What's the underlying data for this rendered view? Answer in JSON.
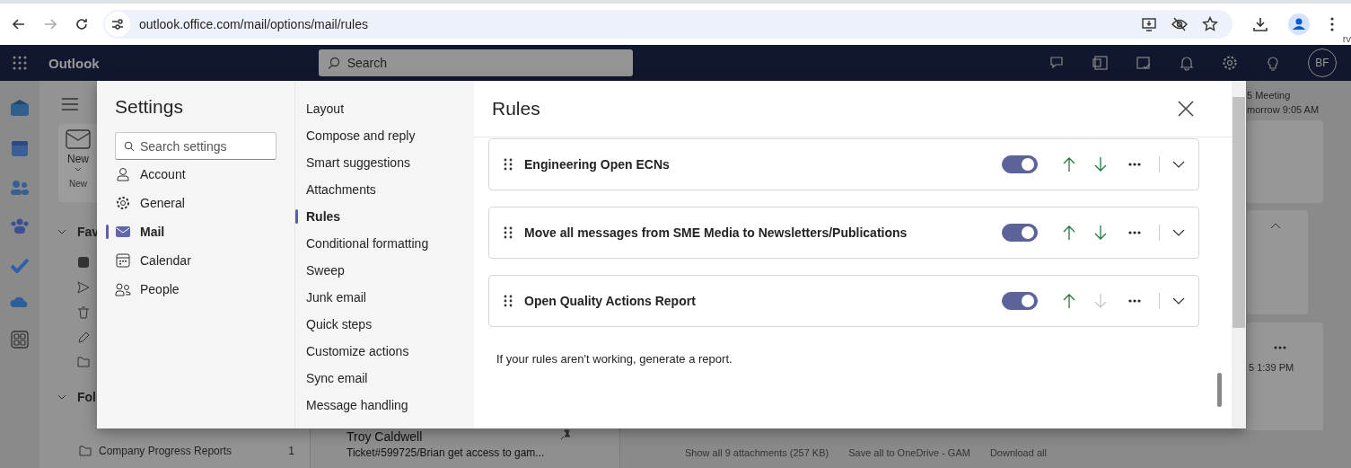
{
  "browser": {
    "url": "outlook.office.com/mail/options/mail/rules"
  },
  "app": {
    "name": "Outlook",
    "search_placeholder": "Search",
    "avatar": "BF"
  },
  "background": {
    "new_button": "New",
    "new_group": "New",
    "favorites": "Fav",
    "folders": "Fol",
    "folder_item": {
      "name": "Company Progress Reports",
      "count": "1"
    },
    "message": {
      "sender": "Troy Caldwell",
      "subject": "Ticket#599725/Brian get access to gam..."
    },
    "event_title": "5 Meeting",
    "event_time": "morrow 9:05 AM",
    "mail_time": "5 1:39 PM",
    "attachments": [
      "Show all 9 attachments (257 KB)",
      "Save all to OneDrive - GAM",
      "Download all"
    ],
    "edge_text": "rv"
  },
  "settings": {
    "title": "Settings",
    "search_placeholder": "Search settings",
    "categories": [
      {
        "label": "Account",
        "selected": false
      },
      {
        "label": "General",
        "selected": false
      },
      {
        "label": "Mail",
        "selected": true
      },
      {
        "label": "Calendar",
        "selected": false
      },
      {
        "label": "People",
        "selected": false
      }
    ],
    "subcategories": [
      {
        "label": "Layout",
        "selected": false
      },
      {
        "label": "Compose and reply",
        "selected": false
      },
      {
        "label": "Smart suggestions",
        "selected": false
      },
      {
        "label": "Attachments",
        "selected": false
      },
      {
        "label": "Rules",
        "selected": true
      },
      {
        "label": "Conditional formatting",
        "selected": false
      },
      {
        "label": "Sweep",
        "selected": false
      },
      {
        "label": "Junk email",
        "selected": false
      },
      {
        "label": "Quick steps",
        "selected": false
      },
      {
        "label": "Customize actions",
        "selected": false
      },
      {
        "label": "Sync email",
        "selected": false
      },
      {
        "label": "Message handling",
        "selected": false
      }
    ],
    "page_title": "Rules",
    "rules": [
      {
        "name": "Engineering Open ECNs",
        "on": true,
        "up_enabled": true,
        "down_enabled": true
      },
      {
        "name": "Move all messages from SME Media to Newsletters/Publications",
        "on": true,
        "up_enabled": true,
        "down_enabled": true
      },
      {
        "name": "Open Quality Actions Report",
        "on": true,
        "up_enabled": true,
        "down_enabled": false
      }
    ],
    "footer": "If your rules aren't working, generate a report."
  }
}
